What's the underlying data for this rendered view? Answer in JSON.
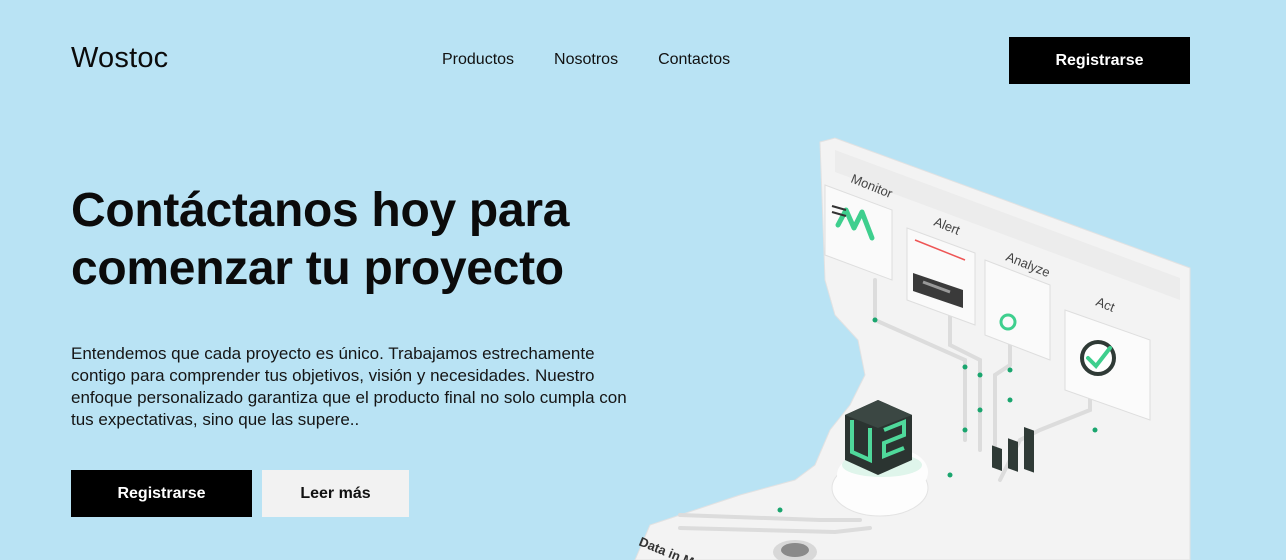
{
  "header": {
    "logo": "Wostoc",
    "nav": [
      "Productos",
      "Nosotros",
      "Contactos"
    ],
    "cta_label": "Registrarse"
  },
  "hero": {
    "title": "Contáctanos hoy para comenzar tu proyecto",
    "description": "Entendemos que cada proyecto es único. Trabajamos estrechamente contigo para comprender tus objetivos, visión y necesidades. Nuestro enfoque personalizado garantiza que el producto final no solo cumpla con tus expectativas, sino que las supere..",
    "primary_label": "Registrarse",
    "secondary_label": "Leer más"
  },
  "illustration": {
    "labels": [
      "Monitor",
      "Alert",
      "Analyze",
      "Act",
      "Data in M"
    ],
    "accent_color": "#3ecf8e",
    "panel_color": "#f4f4f4"
  }
}
